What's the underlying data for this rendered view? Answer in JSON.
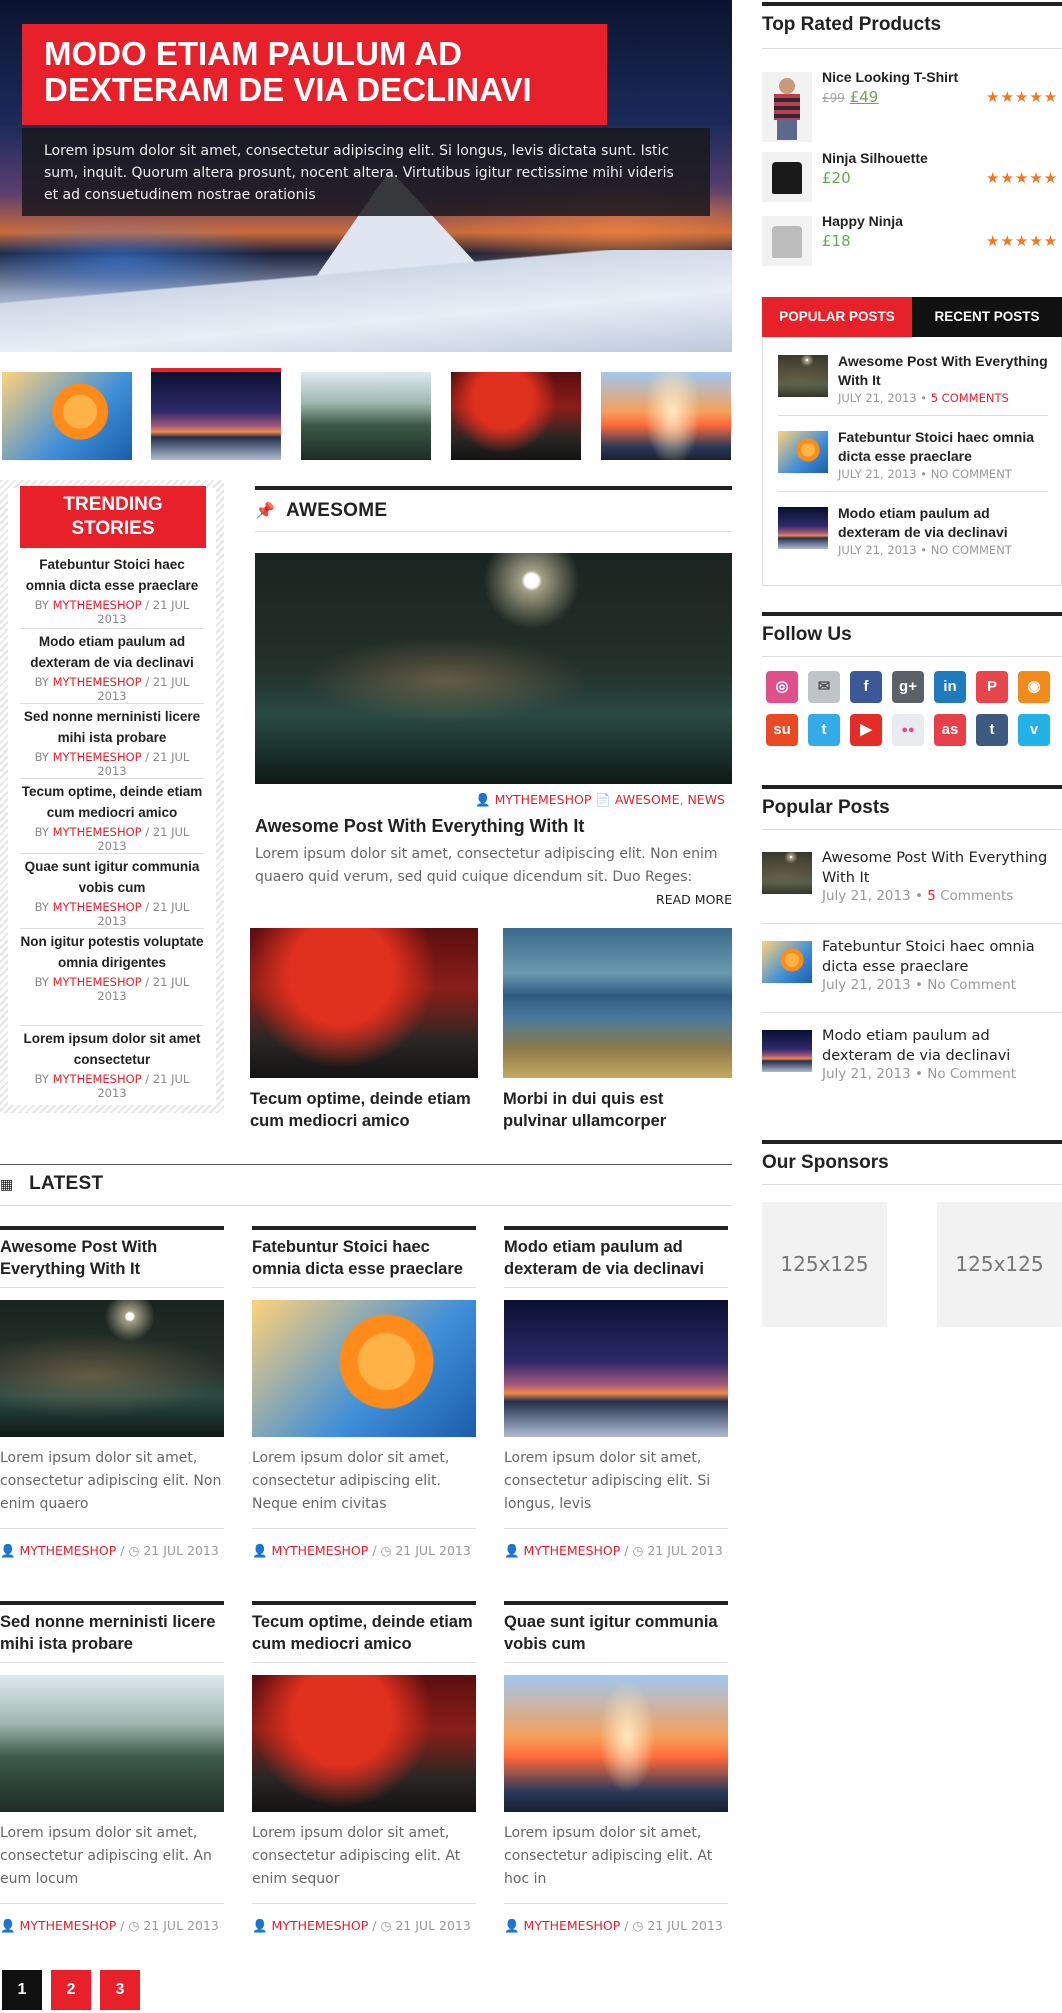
{
  "hero": {
    "title": "MODO ETIAM PAULUM AD DEXTERAM DE VIA DECLINAVI",
    "excerpt": "Lorem ipsum dolor sit amet, consectetur adipiscing elit. Si longus, levis dictata sunt. Istic sum, inquit. Quorum altera prosunt, nocent altera. Virtutibus igitur rectissime mihi videris et ad consuetudinem nostrae orationis"
  },
  "trending": {
    "title": "TRENDING STORIES",
    "items": [
      {
        "title": "Fatebuntur Stoici haec omnia dicta esse praeclare",
        "by": "BY ",
        "author": "MYTHEMESHOP",
        "date": " / 21 JUL 2013"
      },
      {
        "title": "Modo etiam paulum ad dexteram de via declinavi",
        "by": "BY ",
        "author": "MYTHEMESHOP",
        "date": " / 21 JUL 2013"
      },
      {
        "title": "Sed nonne merninisti licere mihi ista probare",
        "by": "BY ",
        "author": "MYTHEMESHOP",
        "date": " / 21 JUL 2013"
      },
      {
        "title": "Tecum optime, deinde etiam cum mediocri amico",
        "by": "BY ",
        "author": "MYTHEMESHOP",
        "date": " / 21 JUL 2013"
      },
      {
        "title": "Quae sunt igitur communia vobis cum",
        "by": "BY ",
        "author": "MYTHEMESHOP",
        "date": " / 21 JUL 2013"
      },
      {
        "title": "Non igitur potestis voluptate omnia dirigentes",
        "by": "BY ",
        "author": "MYTHEMESHOP",
        "date": " / 21 JUL 2013"
      },
      {
        "title": "Lorem ipsum dolor sit amet consectetur",
        "by": "BY ",
        "author": "MYTHEMESHOP",
        "date": " / 21 JUL 2013"
      }
    ]
  },
  "awesome": {
    "section_title": "AWESOME",
    "author": "MYTHEMESHOP",
    "categories": "AWESOME",
    "categories2": "NEWS",
    "post_title": "Awesome Post With Everything With It",
    "excerpt": "Lorem ipsum dolor sit amet, consectetur adipiscing elit. Non enim quaero quid verum, sed quid cuique dicendum sit. Duo Reges:",
    "read_more": "READ MORE",
    "small_posts": [
      {
        "title": "Tecum optime, deinde etiam cum mediocri amico"
      },
      {
        "title": "Morbi in dui quis est pulvinar ullamcorper"
      }
    ]
  },
  "latest": {
    "section_title": "LATEST",
    "posts": [
      {
        "title": "Awesome Post With Everything With It",
        "excerpt": "Lorem ipsum dolor sit amet, consectetur adipiscing elit. Non enim quaero",
        "author": "MYTHEMESHOP",
        "date": "21 JUL 2013"
      },
      {
        "title": "Fatebuntur Stoici haec omnia dicta esse praeclare",
        "excerpt": "Lorem ipsum dolor sit amet, consectetur adipiscing elit. Neque enim civitas",
        "author": "MYTHEMESHOP",
        "date": "21 JUL 2013"
      },
      {
        "title": "Modo etiam paulum ad dexteram de via declinavi",
        "excerpt": "Lorem ipsum dolor sit amet, consectetur adipiscing elit. Si longus, levis",
        "author": "MYTHEMESHOP",
        "date": "21 JUL 2013"
      },
      {
        "title": "Sed nonne merninisti licere mihi ista probare",
        "excerpt": "Lorem ipsum dolor sit amet, consectetur adipiscing elit. An eum locum",
        "author": "MYTHEMESHOP",
        "date": "21 JUL 2013"
      },
      {
        "title": "Tecum optime, deinde etiam cum mediocri amico",
        "excerpt": "Lorem ipsum dolor sit amet, consectetur adipiscing elit. At enim sequor",
        "author": "MYTHEMESHOP",
        "date": "21 JUL 2013"
      },
      {
        "title": "Quae sunt igitur communia vobis cum",
        "excerpt": "Lorem ipsum dolor sit amet, consectetur adipiscing elit. At hoc in",
        "author": "MYTHEMESHOP",
        "date": "21 JUL 2013"
      }
    ],
    "meta_sep": " / "
  },
  "pagination": {
    "pages": [
      "1",
      "2",
      "3"
    ]
  },
  "sidebar": {
    "top_rated": {
      "title": "Top Rated Products",
      "products": [
        {
          "name": "Nice Looking T-Shirt",
          "old_price": "£99",
          "price": "£49",
          "stars": "★★★★★"
        },
        {
          "name": "Ninja Silhouette",
          "price": "£20",
          "stars": "★★★★★"
        },
        {
          "name": "Happy Ninja",
          "price": "£18",
          "stars": "★★★★★"
        }
      ]
    },
    "tabs": {
      "popular_label": "POPULAR POSTS",
      "recent_label": "RECENT POSTS",
      "posts": [
        {
          "title": "Awesome Post With Everything With It",
          "date": "JULY 21, 2013 • ",
          "comments": "5 COMMENTS"
        },
        {
          "title": "Fatebuntur Stoici haec omnia dicta esse praeclare",
          "date": "JULY 21, 2013 • ",
          "comments": "NO COMMENT"
        },
        {
          "title": "Modo etiam paulum ad dexteram de via declinavi",
          "date": "JULY 21, 2013 • ",
          "comments": "NO COMMENT"
        }
      ]
    },
    "follow": {
      "title": "Follow Us",
      "icons": [
        {
          "name": "dribbble-icon",
          "glyph": "◎",
          "color": "#e0518c"
        },
        {
          "name": "email-icon",
          "glyph": "✉",
          "color": "#bfc4c9"
        },
        {
          "name": "facebook-icon",
          "glyph": "f",
          "color": "#3b5998"
        },
        {
          "name": "googleplus-icon",
          "glyph": "g+",
          "color": "#5a6268"
        },
        {
          "name": "linkedin-icon",
          "glyph": "in",
          "color": "#1f7bbf"
        },
        {
          "name": "pinterest-icon",
          "glyph": "P",
          "color": "#e8464a"
        },
        {
          "name": "rss-icon",
          "glyph": "◉",
          "color": "#f28a1c"
        },
        {
          "name": "stumbleupon-icon",
          "glyph": "su",
          "color": "#eb4924"
        },
        {
          "name": "twitter-icon",
          "glyph": "t",
          "color": "#35aae8"
        },
        {
          "name": "youtube-icon",
          "glyph": "▶",
          "color": "#e52d27"
        },
        {
          "name": "flickr-icon",
          "glyph": "●●",
          "color": "#e9ecef"
        },
        {
          "name": "lastfm-icon",
          "glyph": "as",
          "color": "#e8404a"
        },
        {
          "name": "tumblr-icon",
          "glyph": "t",
          "color": "#3d5a80"
        },
        {
          "name": "vimeo-icon",
          "glyph": "v",
          "color": "#22b2e8"
        }
      ]
    },
    "popular": {
      "title": "Popular Posts",
      "posts": [
        {
          "title": "Awesome Post With Everything With It",
          "date": "July 21, 2013 • ",
          "comments_num": "5",
          "comments": " Comments"
        },
        {
          "title": "Fatebuntur Stoici haec omnia dicta esse praeclare",
          "date": "July 21, 2013 • ",
          "comments_num": "",
          "comments": "No Comment"
        },
        {
          "title": "Modo etiam paulum ad dexteram de via declinavi",
          "date": "July 21, 2013 • ",
          "comments_num": "",
          "comments": "No Comment"
        }
      ]
    },
    "sponsors": {
      "title": "Our Sponsors",
      "ads": [
        "125x125",
        "125x125"
      ]
    }
  },
  "colors": {
    "accent": "#e8202a",
    "star": "#f07820",
    "price": "#6aa84f"
  }
}
